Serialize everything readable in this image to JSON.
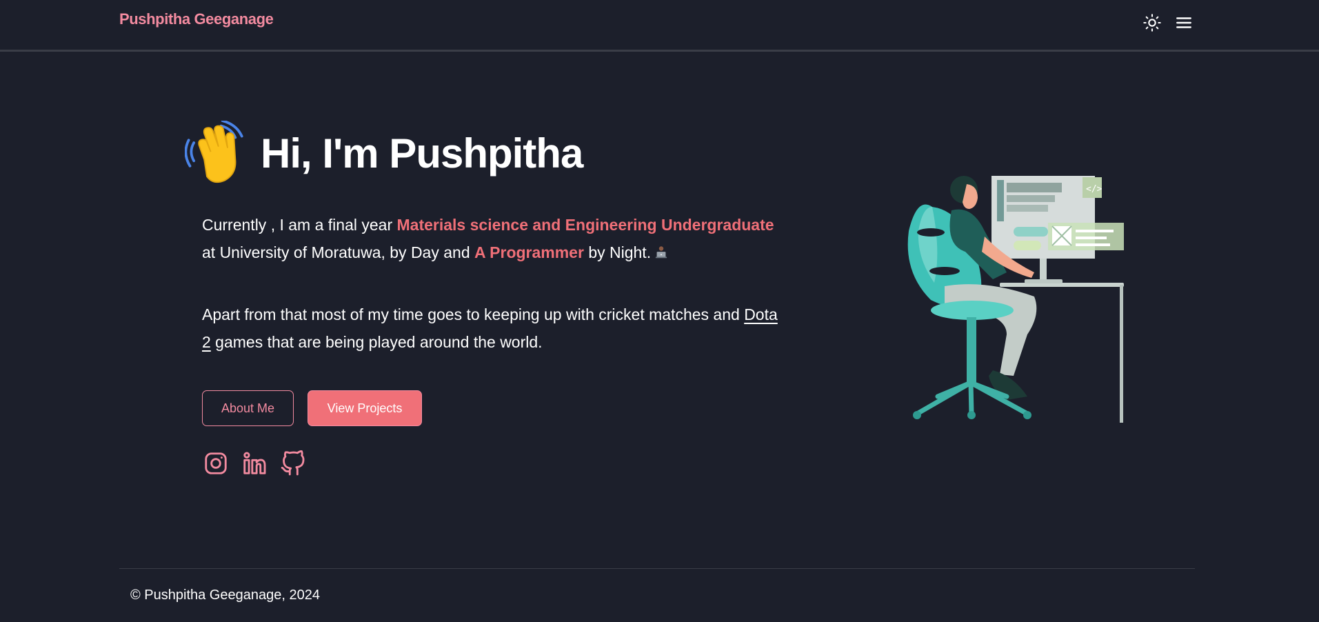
{
  "nav": {
    "brand": "Pushpitha Geeganage",
    "theme_toggle_icon": "sun-icon",
    "menu_icon": "hamburger-menu-icon"
  },
  "hero": {
    "wave_icon": "waving-hand-icon",
    "title": "Hi, I'm Pushpitha",
    "para1": {
      "t1": "Currently , I am a final year ",
      "h1": "Materials science and Engineering Undergraduate",
      "t2": " at University of Moratuwa, by Day and ",
      "h2": "A Programmer",
      "t3": " by Night.",
      "emoji_icon": "laptop-person-icon"
    },
    "para2": {
      "t1": "Apart from that most of my time goes to keeping up with cricket matches and ",
      "link": "Dota 2",
      "t2": " games that are being played around the world."
    },
    "about_button": "About Me",
    "projects_button": "View Projects",
    "socials": [
      "instagram-icon",
      "linkedin-icon",
      "github-icon"
    ],
    "illustration": "developer-at-desk-illustration"
  },
  "footer": {
    "copyright": "© Pushpitha Geeganage, 2024"
  },
  "colors": {
    "background": "#1c1f2b",
    "accent": "#f07078",
    "accent_light": "#f38ba0",
    "text": "#ffffff"
  }
}
